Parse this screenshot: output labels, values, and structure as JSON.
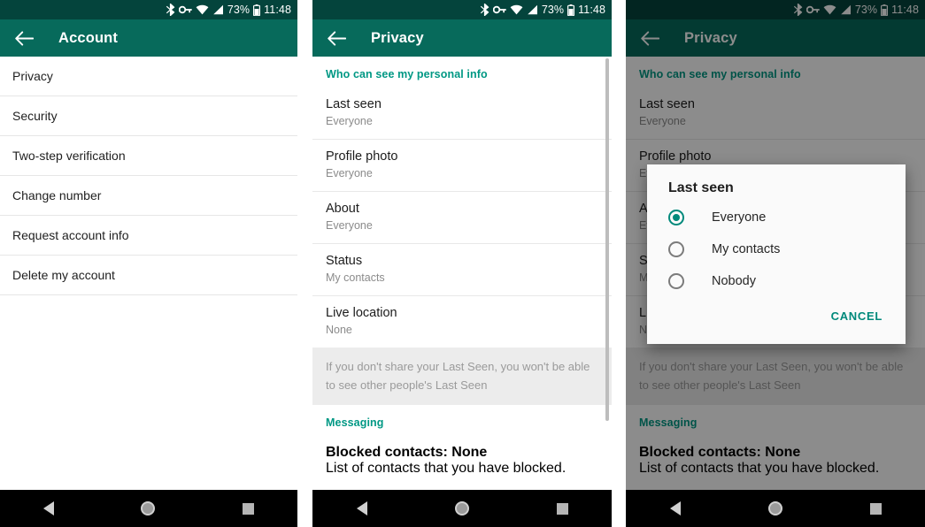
{
  "statusbar": {
    "battery_percent": "73%",
    "time": "11:48",
    "icons": [
      "bluetooth-icon",
      "vpn-key-icon",
      "wifi-icon",
      "signal-icon",
      "battery-icon"
    ]
  },
  "colors": {
    "statusbar_bg": "#04443c",
    "appbar_bg": "#076a5b",
    "accent_teal": "#009884",
    "dialog_accent": "#00897b",
    "navbar_bg": "#000000"
  },
  "panels": [
    {
      "id": "account",
      "appbar": {
        "title": "Account",
        "back_icon": "arrow-back-icon"
      },
      "rows": [
        {
          "label": "Privacy"
        },
        {
          "label": "Security"
        },
        {
          "label": "Two-step verification"
        },
        {
          "label": "Change number"
        },
        {
          "label": "Request account info"
        },
        {
          "label": "Delete my account"
        }
      ]
    },
    {
      "id": "privacy",
      "appbar": {
        "title": "Privacy",
        "back_icon": "arrow-back-icon"
      },
      "section_personal": "Who can see my personal info",
      "options": [
        {
          "title": "Last seen",
          "value": "Everyone"
        },
        {
          "title": "Profile photo",
          "value": "Everyone"
        },
        {
          "title": "About",
          "value": "Everyone"
        },
        {
          "title": "Status",
          "value": "My contacts"
        },
        {
          "title": "Live location",
          "value": "None"
        }
      ],
      "note": "If you don't share your Last Seen, you won't be able to see other people's Last Seen",
      "section_messaging": "Messaging",
      "blocked": {
        "title": "Blocked contacts: None",
        "value": "List of contacts that you have blocked."
      }
    },
    {
      "id": "privacy-dialog",
      "appbar": {
        "title": "Privacy",
        "back_icon": "arrow-back-icon"
      },
      "dialog": {
        "title": "Last seen",
        "options": [
          {
            "label": "Everyone",
            "selected": true
          },
          {
            "label": "My contacts",
            "selected": false
          },
          {
            "label": "Nobody",
            "selected": false
          }
        ],
        "cancel_label": "CANCEL"
      }
    }
  ],
  "navbar": {
    "back": "nav-back-icon",
    "home": "nav-home-icon",
    "recents": "nav-recents-icon"
  }
}
